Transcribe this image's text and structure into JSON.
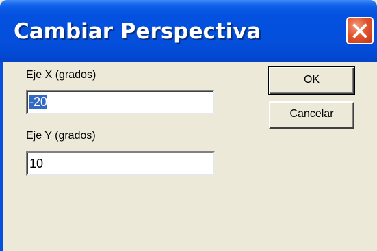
{
  "window": {
    "title": "Cambiar Perspectiva",
    "close_icon": "close-icon"
  },
  "fields": {
    "x_label": "Eje X (grados)",
    "x_value": "-20",
    "y_label": "Eje Y (grados)",
    "y_value": "10"
  },
  "buttons": {
    "ok_label": "OK",
    "cancel_label": "Cancelar"
  },
  "colors": {
    "titlebar": "#0451df",
    "dialog_bg": "#ece9d8",
    "selection": "#316ac5",
    "close_button": "#e0562f"
  }
}
